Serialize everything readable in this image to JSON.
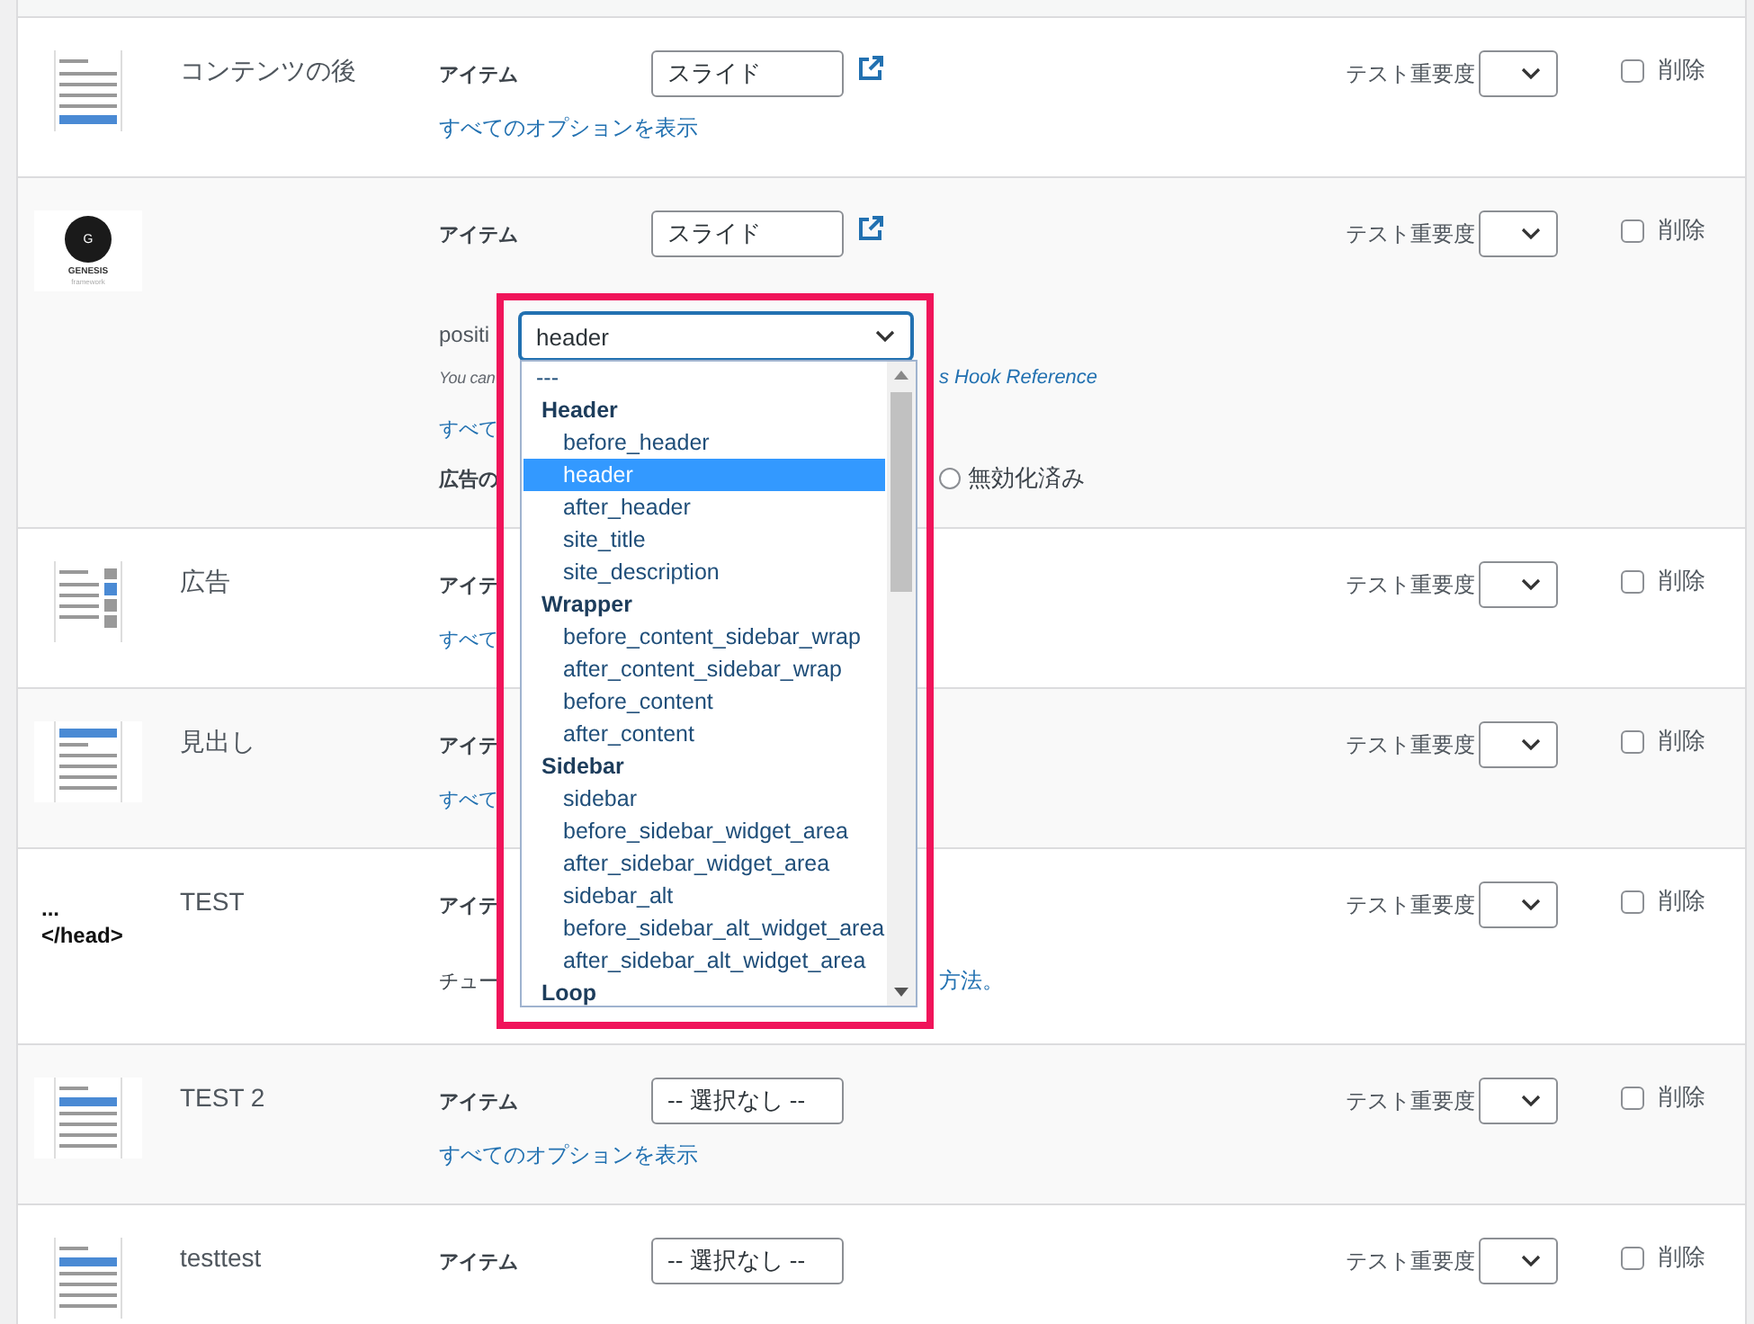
{
  "rows": [
    {
      "thumbnail": {
        "kind": "doc-bottom"
      },
      "title": "コンテンツの後",
      "item_label": "アイテム",
      "item_value": "スライド",
      "external_link": true,
      "lines": [
        {
          "kind": "link",
          "text": "すべてのオプションを表示"
        }
      ],
      "importance_label": "テスト重要度",
      "delete_label": "削除",
      "delete_checked": false
    },
    {
      "thumbnail": {
        "kind": "genesis",
        "letter": "G",
        "name": "GENESIS",
        "tagline": "framework"
      },
      "item_label": "アイテム",
      "item_value": "スライド",
      "external_link": true,
      "lines": [
        {
          "kind": "field_label",
          "text": "positi"
        },
        {
          "kind": "note",
          "text": "You can",
          "tail": "s Hook Reference"
        },
        {
          "kind": "link",
          "text": "すべて"
        },
        {
          "kind": "toggle",
          "text": "広告の",
          "option": "無効化済み",
          "checked": false
        }
      ],
      "importance_label": "テスト重要度",
      "delete_label": "削除",
      "delete_checked": false
    },
    {
      "thumbnail": {
        "kind": "doc-sidebar"
      },
      "title": "広告",
      "item_label": "アイテ",
      "external_link": false,
      "lines": [
        {
          "kind": "link",
          "text": "すべて"
        }
      ],
      "importance_label": "テスト重要度",
      "delete_label": "削除",
      "delete_checked": false
    },
    {
      "thumbnail": {
        "kind": "doc-top"
      },
      "title": "見出し",
      "item_label": "アイテ",
      "external_link": false,
      "lines": [
        {
          "kind": "link",
          "text": "すべて"
        }
      ],
      "importance_label": "テスト重要度",
      "delete_label": "削除",
      "delete_checked": false
    },
    {
      "thumbnail": {
        "kind": "code",
        "line1": "...",
        "line2": "</head>"
      },
      "title": "TEST",
      "item_label": "アイテ",
      "external_link": false,
      "lines": [
        {
          "kind": "split",
          "text": "チュー",
          "tail": "方法。"
        }
      ],
      "importance_label": "テスト重要度",
      "delete_label": "削除",
      "delete_checked": false
    },
    {
      "thumbnail": {
        "kind": "doc-second"
      },
      "title": "TEST 2",
      "item_label": "アイテム",
      "item_value": "-- 選択なし --",
      "external_link": false,
      "lines": [
        {
          "kind": "link",
          "text": "すべてのオプションを表示"
        }
      ],
      "importance_label": "テスト重要度",
      "delete_label": "削除",
      "delete_checked": false
    },
    {
      "thumbnail": {
        "kind": "doc-second"
      },
      "title": "testtest",
      "item_label": "アイテム",
      "item_value": "-- 選択なし --",
      "external_link": false,
      "lines": [],
      "importance_label": "テスト重要度",
      "delete_label": "削除",
      "delete_checked": false
    }
  ],
  "dropdown": {
    "value": "header",
    "items": [
      {
        "kind": "none",
        "text": "---",
        "selected": false
      },
      {
        "kind": "group",
        "text": "Header",
        "selected": false
      },
      {
        "kind": "option",
        "text": "before_header",
        "selected": false
      },
      {
        "kind": "option",
        "text": "header",
        "selected": true
      },
      {
        "kind": "option",
        "text": "after_header",
        "selected": false
      },
      {
        "kind": "option",
        "text": "site_title",
        "selected": false
      },
      {
        "kind": "option",
        "text": "site_description",
        "selected": false
      },
      {
        "kind": "group",
        "text": "Wrapper",
        "selected": false
      },
      {
        "kind": "option",
        "text": "before_content_sidebar_wrap",
        "selected": false
      },
      {
        "kind": "option",
        "text": "after_content_sidebar_wrap",
        "selected": false
      },
      {
        "kind": "option",
        "text": "before_content",
        "selected": false
      },
      {
        "kind": "option",
        "text": "after_content",
        "selected": false
      },
      {
        "kind": "group",
        "text": "Sidebar",
        "selected": false
      },
      {
        "kind": "option",
        "text": "sidebar",
        "selected": false
      },
      {
        "kind": "option",
        "text": "before_sidebar_widget_area",
        "selected": false
      },
      {
        "kind": "option",
        "text": "after_sidebar_widget_area",
        "selected": false
      },
      {
        "kind": "option",
        "text": "sidebar_alt",
        "selected": false
      },
      {
        "kind": "option",
        "text": "before_sidebar_alt_widget_area",
        "selected": false
      },
      {
        "kind": "option",
        "text": "after_sidebar_alt_widget_area",
        "selected": false
      },
      {
        "kind": "group",
        "text": "Loop",
        "selected": false
      }
    ]
  }
}
